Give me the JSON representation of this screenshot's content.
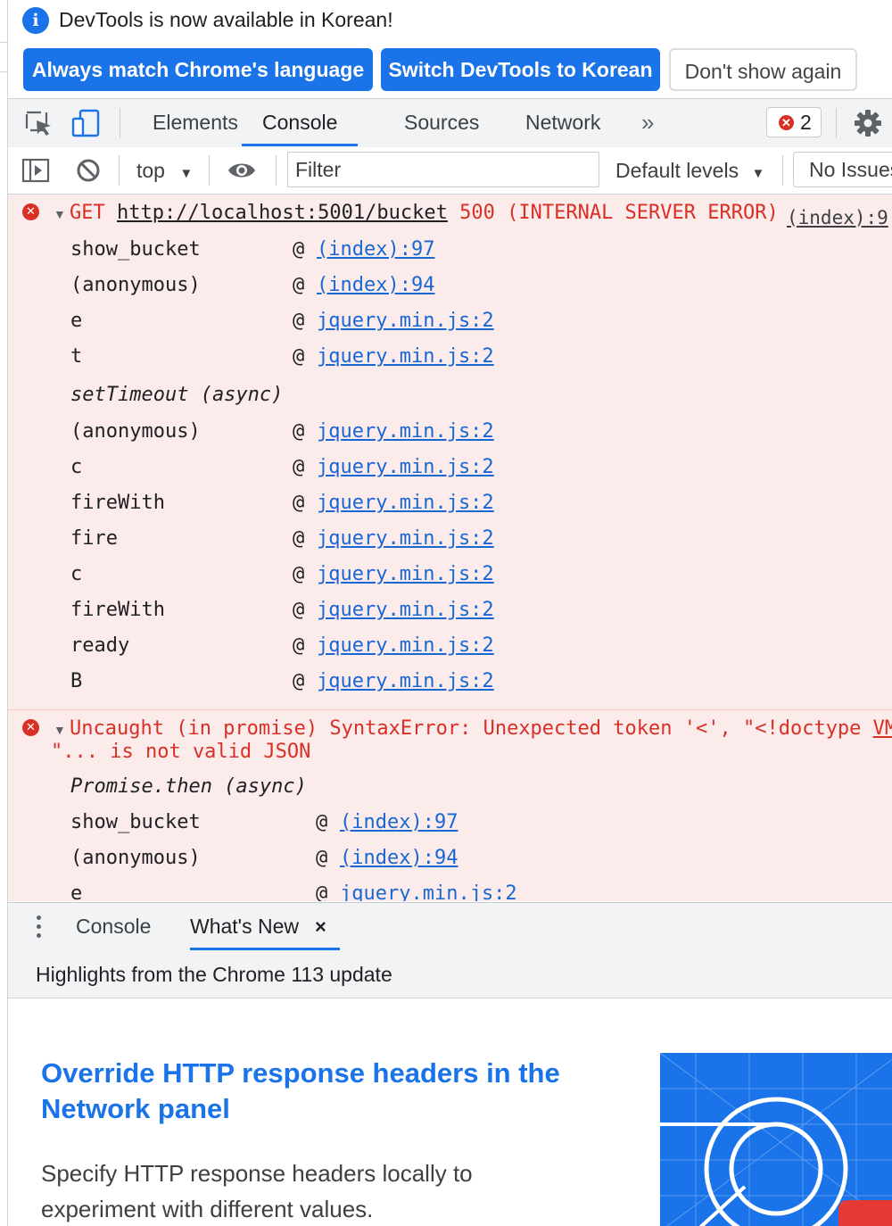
{
  "infobar": {
    "message": "DevTools is now available in Korean!",
    "btn_match": "Always match Chrome's language",
    "btn_switch": "Switch DevTools to Korean",
    "btn_dismiss": "Don't show again"
  },
  "tabs": {
    "elements": "Elements",
    "console": "Console",
    "sources": "Sources",
    "network": "Network",
    "more": "»",
    "error_count": "2"
  },
  "toolbar": {
    "context": "top",
    "filter_placeholder": "Filter",
    "levels": "Default levels",
    "issues": "No Issues"
  },
  "messages": [
    {
      "method": "GET",
      "url": "http://localhost:5001/bucket",
      "status": "500 (INTERNAL SERVER ERROR)",
      "source": "(index):9",
      "frames": [
        {
          "fn": "show_bucket",
          "loc": "(index):97"
        },
        {
          "fn": "(anonymous)",
          "loc": "(index):94"
        },
        {
          "fn": "e",
          "loc": "jquery.min.js:2"
        },
        {
          "fn": "t",
          "loc": "jquery.min.js:2"
        },
        {
          "async": "setTimeout (async)"
        },
        {
          "fn": "(anonymous)",
          "loc": "jquery.min.js:2"
        },
        {
          "fn": "c",
          "loc": "jquery.min.js:2"
        },
        {
          "fn": "fireWith",
          "loc": "jquery.min.js:2"
        },
        {
          "fn": "fire",
          "loc": "jquery.min.js:2"
        },
        {
          "fn": "c",
          "loc": "jquery.min.js:2"
        },
        {
          "fn": "fireWith",
          "loc": "jquery.min.js:2"
        },
        {
          "fn": "ready",
          "loc": "jquery.min.js:2"
        },
        {
          "fn": "B",
          "loc": "jquery.min.js:2"
        }
      ]
    },
    {
      "line1": "Uncaught (in promise) SyntaxError: Unexpected token '<', \"<!doctype ",
      "line1_link": "VM",
      "line2": "\"... is not valid JSON",
      "frames": [
        {
          "async": "Promise.then (async)"
        },
        {
          "fn": "show_bucket",
          "loc": "(index):97"
        },
        {
          "fn": "(anonymous)",
          "loc": "(index):94"
        },
        {
          "fn": "e",
          "loc": "jquery.min.js:2"
        }
      ]
    }
  ],
  "drawer": {
    "tab_console": "Console",
    "tab_whats_new": "What's New",
    "close": "×",
    "header": "Highlights from the Chrome 113 update",
    "feature_title": "Override HTTP response headers in the Network panel",
    "feature_desc": "Specify HTTP response headers locally to experiment with different values."
  },
  "colors": {
    "accent": "#1a73e8",
    "error": "#d93025",
    "error_bg": "#fcebeb",
    "link": "#1967d2"
  }
}
